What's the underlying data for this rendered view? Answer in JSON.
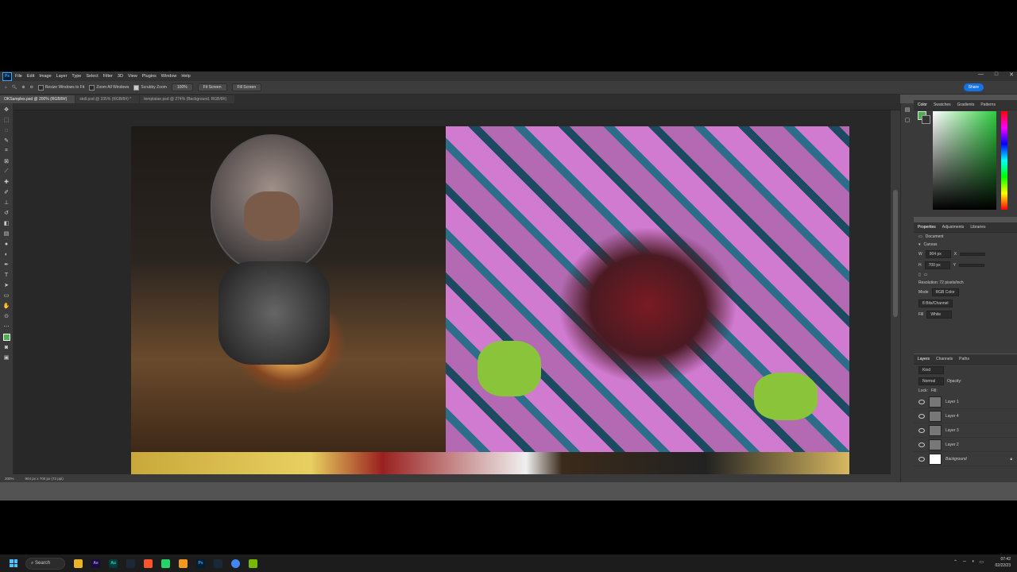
{
  "app": {
    "logo": "Ps",
    "menu": [
      "File",
      "Edit",
      "Image",
      "Layer",
      "Type",
      "Select",
      "Filter",
      "3D",
      "View",
      "Plugins",
      "Window",
      "Help"
    ],
    "window_controls": [
      "—",
      "□",
      "✕"
    ]
  },
  "options": {
    "resize_windows": "Resize Windows to Fit",
    "zoom_all": "Zoom All Windows",
    "scrubby_zoom": "Scrubby Zoom",
    "zoom_value": "100%",
    "fit_screen": "Fit Screen",
    "fill_screen": "Fill Screen",
    "share": "Share"
  },
  "tabs": [
    {
      "label": "OKSamples.psd @ 200% (RGB/8#)",
      "active": true
    },
    {
      "label": "stoll.psd @ 335% (RGB/8#) *",
      "active": false
    },
    {
      "label": "templatae.psd @ 274% (Background, RGB/8#)",
      "active": false
    }
  ],
  "status": {
    "zoom": "200%",
    "size": "904 px x 700 px (72 ppi)"
  },
  "color_panel": {
    "tabs": [
      "Color",
      "Swatches",
      "Gradients",
      "Patterns"
    ],
    "fg": "#4caf50",
    "bg": "#333333"
  },
  "properties": {
    "tabs": [
      "Properties",
      "Adjustments",
      "Libraries"
    ],
    "doc_label": "Document",
    "section": "Canvas",
    "w_label": "W",
    "w_value": "904 px",
    "h_label": "H",
    "h_value": "700 px",
    "x_label": "X",
    "y_label": "Y",
    "resolution": "Resolution: 72 pixels/inch",
    "mode_label": "Mode",
    "mode_value": "RGB Color",
    "depth_value": "8 Bits/Channel",
    "fill_label": "Fill",
    "fill_value": "White"
  },
  "layers_panel": {
    "tabs": [
      "Layers",
      "Channels",
      "Paths"
    ],
    "kind": "Kind",
    "blend": "Normal",
    "opacity_label": "Opacity:",
    "lock_label": "Lock:",
    "fill_label": "Fill:",
    "layers": [
      "Layer 1",
      "Layer 4",
      "Layer 3",
      "Layer 2",
      "Background"
    ]
  },
  "taskbar": {
    "search": "Search",
    "icons": [
      "Ae",
      "Au",
      "Ps"
    ],
    "time": "07:42",
    "date": "02/22/23"
  }
}
